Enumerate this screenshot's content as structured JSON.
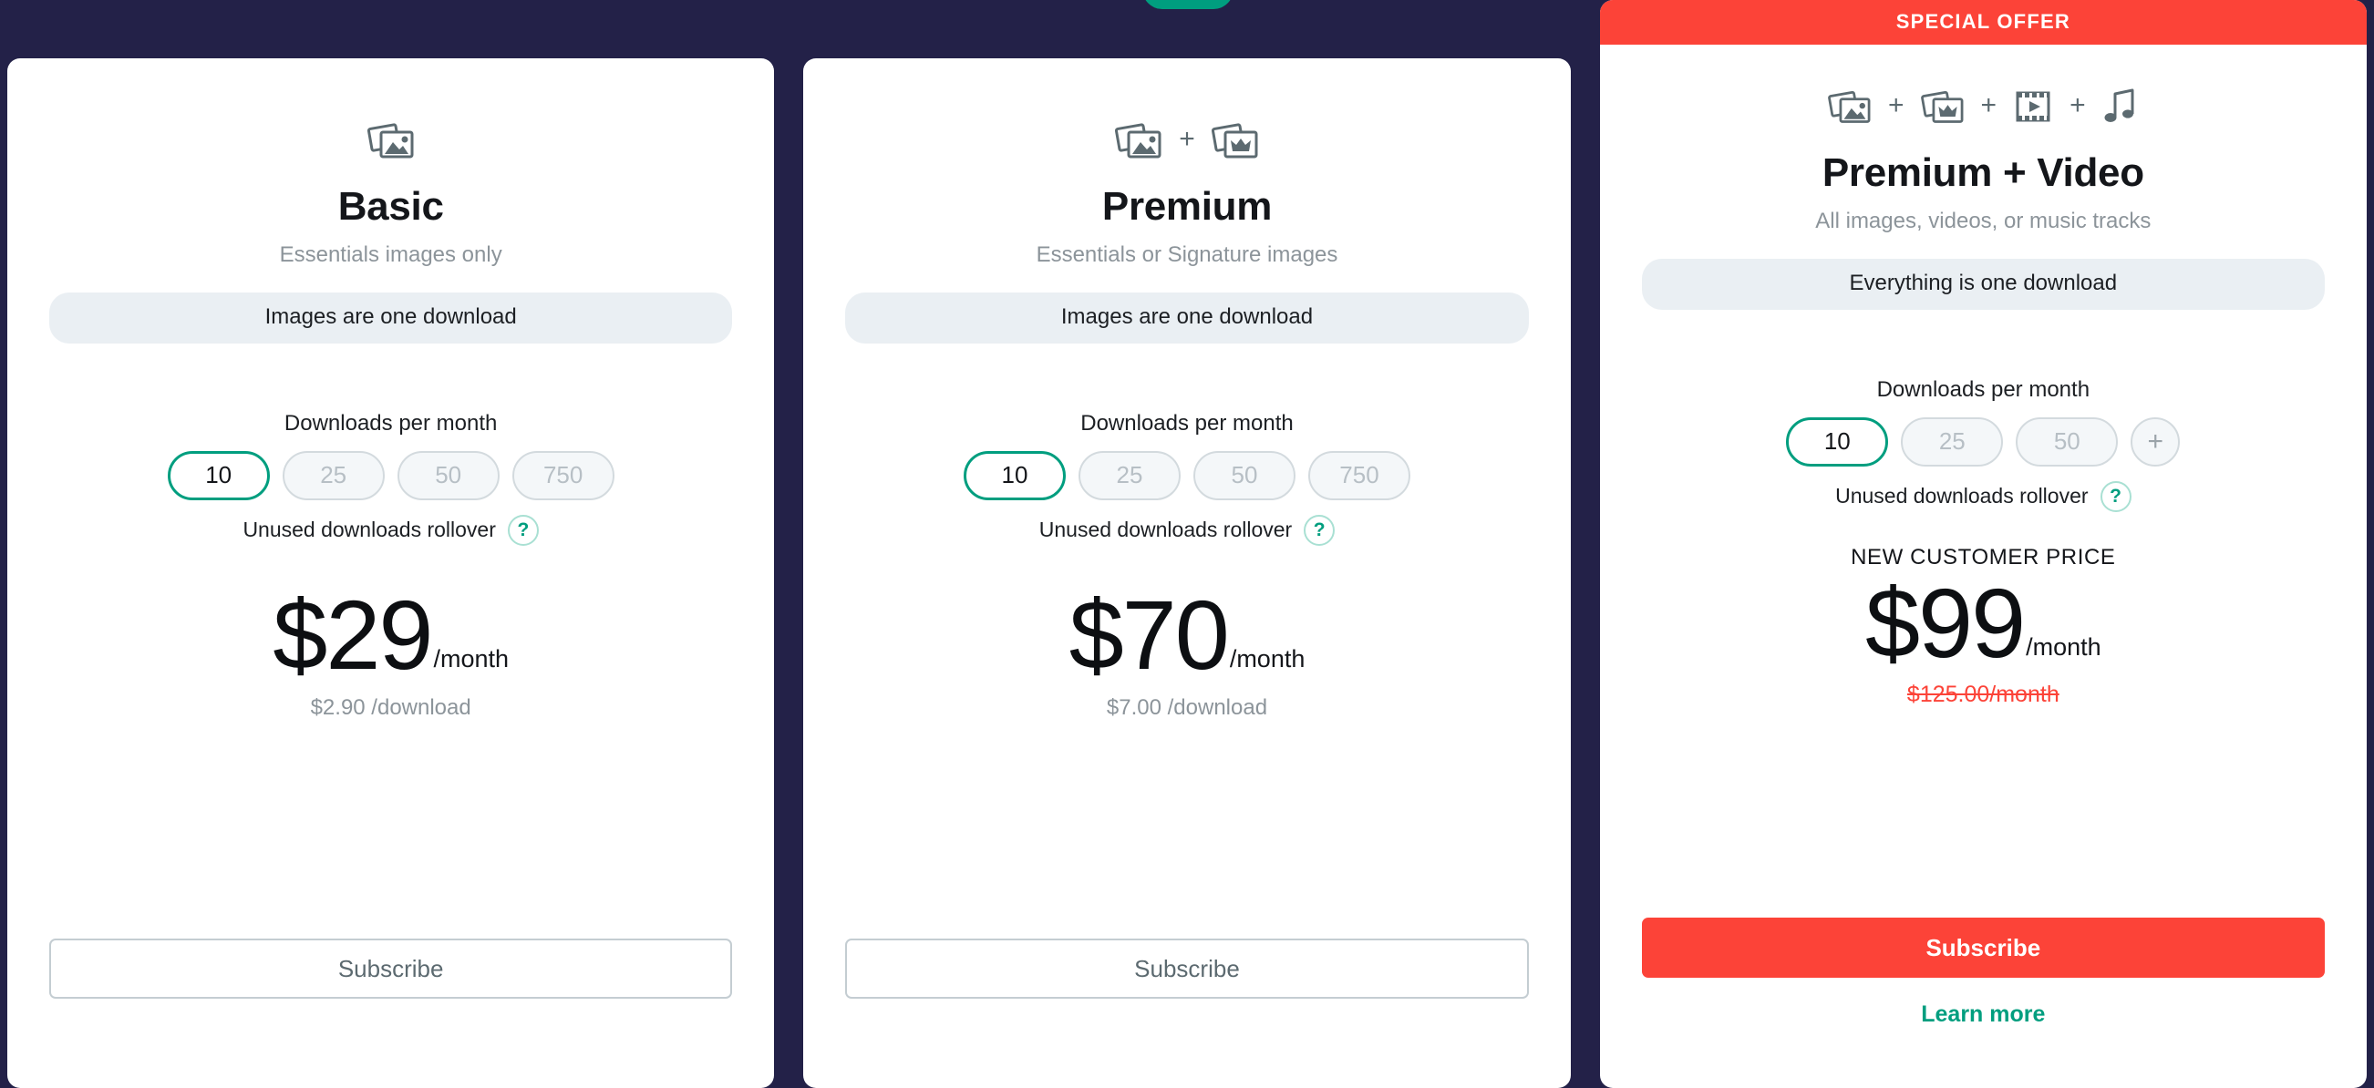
{
  "background_color": "#232148",
  "accent_teal": "#009E7F",
  "accent_red": "#FC4338",
  "top_tab": {
    "name": "teal-tab"
  },
  "cards": [
    {
      "id": "basic",
      "banner": null,
      "icons": [
        "photo-stack-icon"
      ],
      "title": "Basic",
      "subtitle": "Essentials images only",
      "download_chip": "Images are one download",
      "selector_label": "Downloads per month",
      "options": [
        "10",
        "25",
        "50",
        "750"
      ],
      "selected": "10",
      "rollover_label": "Unused downloads rollover",
      "help_glyph": "?",
      "new_customer_label": null,
      "price": "$29",
      "price_period": "/month",
      "price_unit": "$2.90 /download",
      "price_old": null,
      "cta_label": "Subscribe",
      "cta_style": "outline",
      "learn_more": null
    },
    {
      "id": "premium",
      "banner": null,
      "icons": [
        "photo-stack-icon",
        "photo-stack-crown-icon"
      ],
      "title": "Premium",
      "subtitle": "Essentials or Signature images",
      "download_chip": "Images are one download",
      "selector_label": "Downloads per month",
      "options": [
        "10",
        "25",
        "50",
        "750"
      ],
      "selected": "10",
      "rollover_label": "Unused downloads rollover",
      "help_glyph": "?",
      "new_customer_label": null,
      "price": "$70",
      "price_period": "/month",
      "price_unit": "$7.00 /download",
      "price_old": null,
      "cta_label": "Subscribe",
      "cta_style": "outline",
      "learn_more": null
    },
    {
      "id": "premium-video",
      "banner": "SPECIAL OFFER",
      "icons": [
        "photo-stack-icon",
        "photo-stack-crown-icon",
        "film-strip-icon",
        "music-note-icon"
      ],
      "title": "Premium + Video",
      "subtitle": "All images, videos, or music tracks",
      "download_chip": "Everything is one download",
      "selector_label": "Downloads per month",
      "options": [
        "10",
        "25",
        "50",
        "+"
      ],
      "selected": "10",
      "rollover_label": "Unused downloads rollover",
      "help_glyph": "?",
      "new_customer_label": "NEW CUSTOMER PRICE",
      "price": "$99",
      "price_period": "/month",
      "price_unit": null,
      "price_old": "$125.00/month",
      "cta_label": "Subscribe",
      "cta_style": "primary",
      "learn_more": "Learn more"
    }
  ]
}
